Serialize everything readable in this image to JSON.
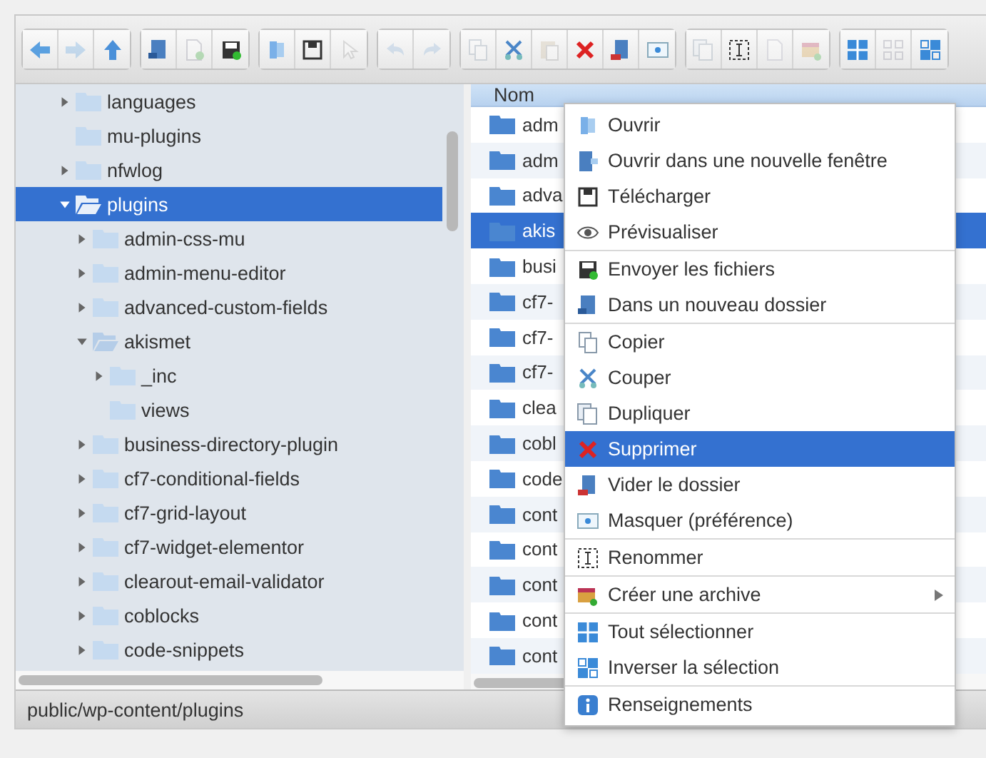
{
  "toolbar": {
    "groups": [
      [
        {
          "kind": "back",
          "disabled": false
        },
        {
          "kind": "forward",
          "disabled": true
        },
        {
          "kind": "up",
          "disabled": false
        }
      ],
      [
        {
          "kind": "newfolder",
          "disabled": false
        },
        {
          "kind": "newfile",
          "disabled": true
        },
        {
          "kind": "upload",
          "disabled": false
        }
      ],
      [
        {
          "kind": "open",
          "disabled": false
        },
        {
          "kind": "download",
          "disabled": false
        },
        {
          "kind": "select",
          "disabled": true
        }
      ],
      [
        {
          "kind": "undo",
          "disabled": true
        },
        {
          "kind": "redo",
          "disabled": true
        }
      ],
      [
        {
          "kind": "copy",
          "disabled": true
        },
        {
          "kind": "cut",
          "disabled": false
        },
        {
          "kind": "paste",
          "disabled": true
        },
        {
          "kind": "delete",
          "disabled": false
        },
        {
          "kind": "empty",
          "disabled": false
        },
        {
          "kind": "hide",
          "disabled": false
        }
      ],
      [
        {
          "kind": "duplicate",
          "disabled": true
        },
        {
          "kind": "rename",
          "disabled": false
        },
        {
          "kind": "edit",
          "disabled": true
        },
        {
          "kind": "archive",
          "disabled": true
        }
      ],
      [
        {
          "kind": "selectall",
          "disabled": false
        },
        {
          "kind": "deselect",
          "disabled": true
        },
        {
          "kind": "invert",
          "disabled": false
        }
      ]
    ]
  },
  "tree": [
    {
      "name": "languages",
      "expandable": true,
      "expanded": false,
      "selected": false
    },
    {
      "name": "mu-plugins",
      "expandable": false,
      "expanded": false,
      "selected": false
    },
    {
      "name": "nfwlog",
      "expandable": true,
      "expanded": false,
      "selected": false
    },
    {
      "name": "plugins",
      "expandable": true,
      "expanded": true,
      "selected": true,
      "children": [
        {
          "name": "admin-css-mu",
          "expandable": true,
          "expanded": false,
          "selected": false
        },
        {
          "name": "admin-menu-editor",
          "expandable": true,
          "expanded": false,
          "selected": false
        },
        {
          "name": "advanced-custom-fields",
          "expandable": true,
          "expanded": false,
          "selected": false
        },
        {
          "name": "akismet",
          "expandable": true,
          "expanded": true,
          "selected": false,
          "children": [
            {
              "name": "_inc",
              "expandable": true,
              "expanded": false,
              "selected": false
            },
            {
              "name": "views",
              "expandable": false,
              "expanded": false,
              "selected": false
            }
          ]
        },
        {
          "name": "business-directory-plugin",
          "expandable": true,
          "expanded": false,
          "selected": false
        },
        {
          "name": "cf7-conditional-fields",
          "expandable": true,
          "expanded": false,
          "selected": false
        },
        {
          "name": "cf7-grid-layout",
          "expandable": true,
          "expanded": false,
          "selected": false
        },
        {
          "name": "cf7-widget-elementor",
          "expandable": true,
          "expanded": false,
          "selected": false
        },
        {
          "name": "clearout-email-validator",
          "expandable": true,
          "expanded": false,
          "selected": false
        },
        {
          "name": "coblocks",
          "expandable": true,
          "expanded": false,
          "selected": false
        },
        {
          "name": "code-snippets",
          "expandable": true,
          "expanded": false,
          "selected": false
        }
      ]
    }
  ],
  "files": {
    "columns": [
      "Nom"
    ],
    "rows": [
      {
        "name": "adm",
        "selected": false
      },
      {
        "name": "adm",
        "selected": false
      },
      {
        "name": "adva",
        "selected": false
      },
      {
        "name": "akis",
        "selected": true
      },
      {
        "name": "busi",
        "selected": false
      },
      {
        "name": "cf7-",
        "selected": false
      },
      {
        "name": "cf7-",
        "selected": false
      },
      {
        "name": "cf7-",
        "selected": false
      },
      {
        "name": "clea",
        "selected": false
      },
      {
        "name": "cobl",
        "selected": false
      },
      {
        "name": "code",
        "selected": false
      },
      {
        "name": "cont",
        "selected": false
      },
      {
        "name": "cont",
        "selected": false
      },
      {
        "name": "cont",
        "selected": false
      },
      {
        "name": "cont",
        "selected": false
      },
      {
        "name": "cont",
        "selected": false
      }
    ]
  },
  "context_menu": {
    "sections": [
      [
        {
          "label": "Ouvrir",
          "kind": "open",
          "selected": false,
          "submenu": false
        },
        {
          "label": "Ouvrir dans une nouvelle fenêtre",
          "kind": "openwin",
          "selected": false,
          "submenu": false
        },
        {
          "label": "Télécharger",
          "kind": "download",
          "selected": false,
          "submenu": false
        },
        {
          "label": "Prévisualiser",
          "kind": "preview",
          "selected": false,
          "submenu": false
        }
      ],
      [
        {
          "label": "Envoyer les fichiers",
          "kind": "upload",
          "selected": false,
          "submenu": false
        },
        {
          "label": "Dans un nouveau dossier",
          "kind": "newfolder",
          "selected": false,
          "submenu": false
        }
      ],
      [
        {
          "label": "Copier",
          "kind": "copy",
          "selected": false,
          "submenu": false
        },
        {
          "label": "Couper",
          "kind": "cut",
          "selected": false,
          "submenu": false
        },
        {
          "label": "Dupliquer",
          "kind": "duplicate",
          "selected": false,
          "submenu": false
        },
        {
          "label": "Supprimer",
          "kind": "delete",
          "selected": true,
          "submenu": false
        },
        {
          "label": "Vider le dossier",
          "kind": "empty",
          "selected": false,
          "submenu": false
        },
        {
          "label": "Masquer (préférence)",
          "kind": "hide",
          "selected": false,
          "submenu": false
        }
      ],
      [
        {
          "label": "Renommer",
          "kind": "rename",
          "selected": false,
          "submenu": false
        }
      ],
      [
        {
          "label": "Créer une archive",
          "kind": "archive",
          "selected": false,
          "submenu": true
        }
      ],
      [
        {
          "label": "Tout sélectionner",
          "kind": "selectall",
          "selected": false,
          "submenu": false
        },
        {
          "label": "Inverser la sélection",
          "kind": "invert",
          "selected": false,
          "submenu": false
        }
      ],
      [
        {
          "label": "Renseignements",
          "kind": "info",
          "selected": false,
          "submenu": false
        }
      ]
    ]
  },
  "status_bar": {
    "path": "public/wp-content/plugins"
  }
}
